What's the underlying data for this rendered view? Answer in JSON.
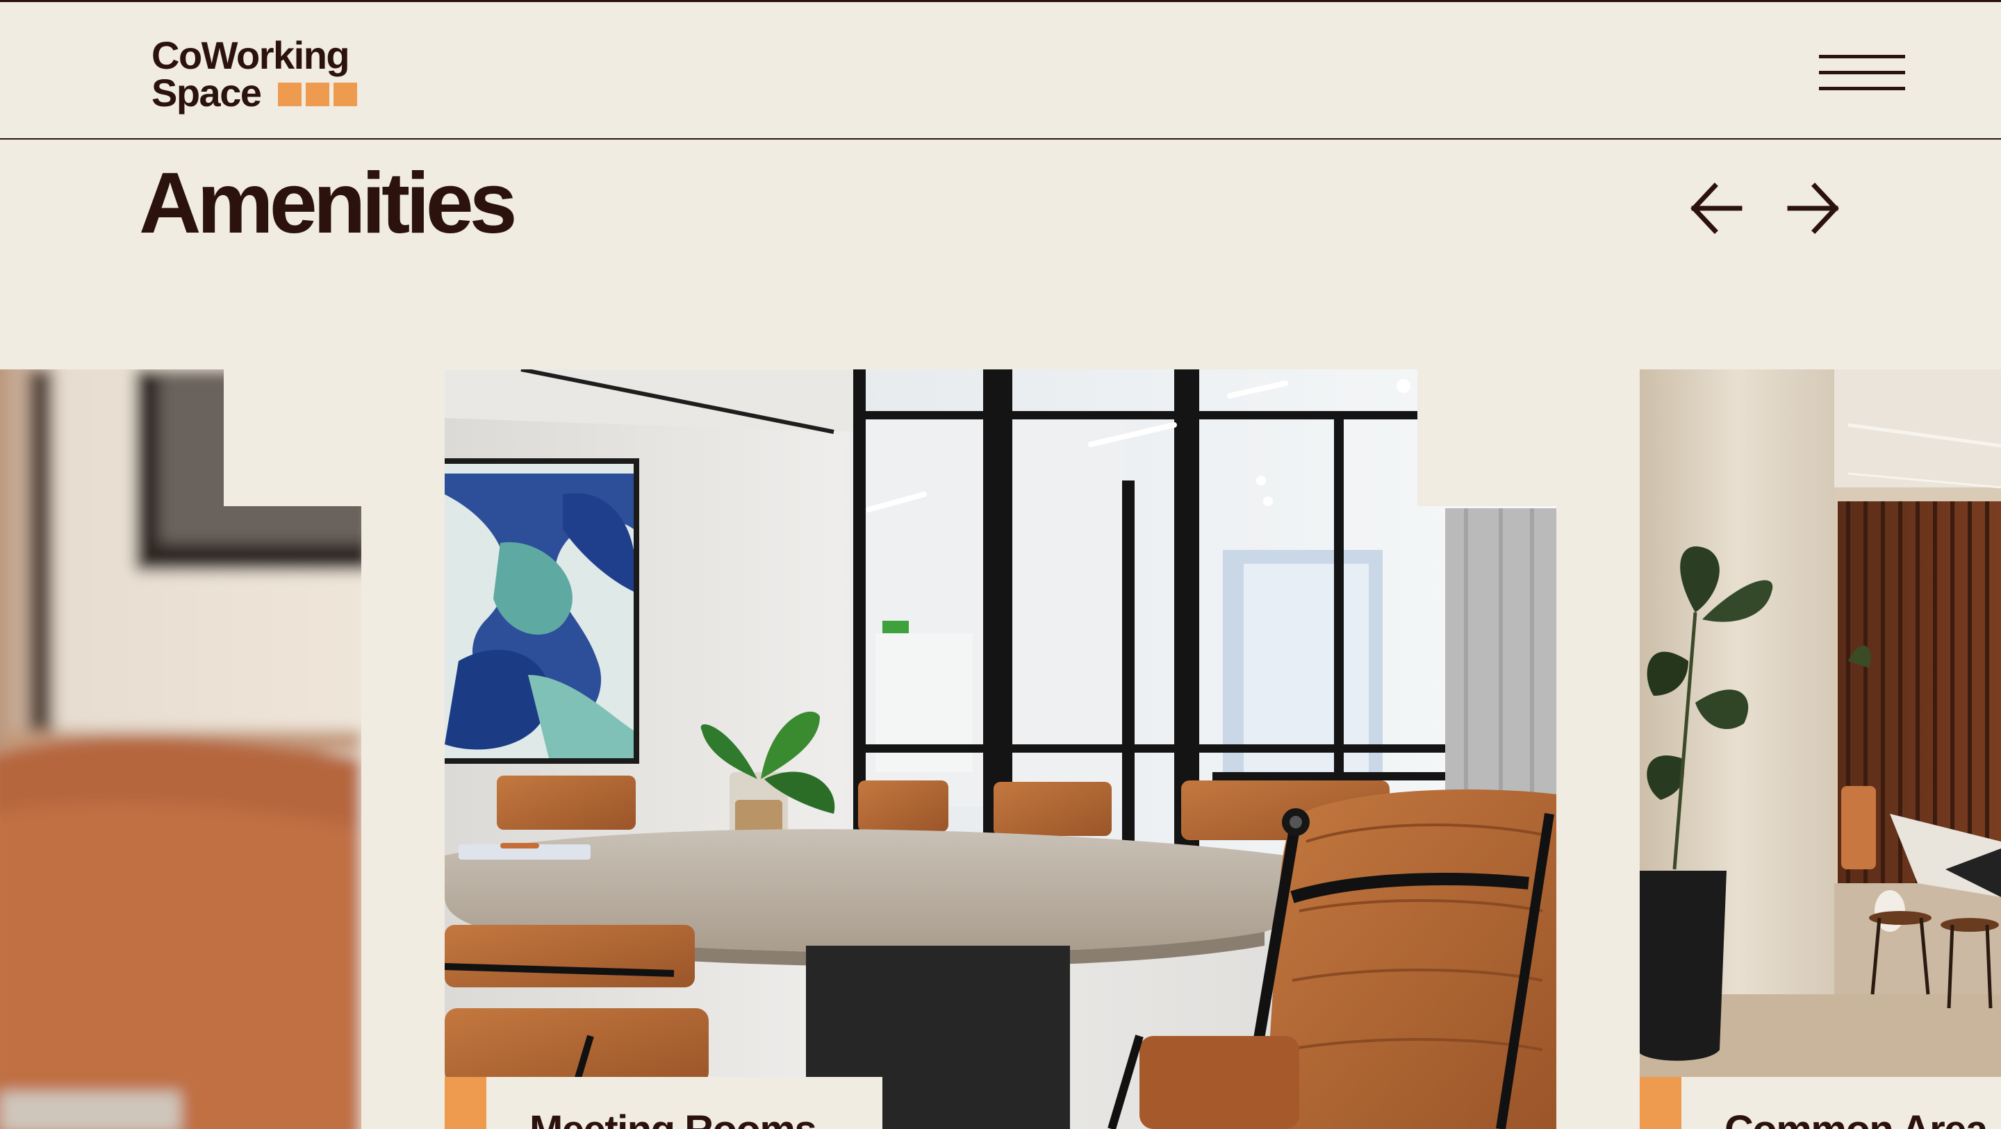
{
  "brand": {
    "name_line1": "CoWorking",
    "name_line2": "Space",
    "accent_color": "#ee9a4f",
    "text_color": "#2b120d",
    "background": "#f1ece2"
  },
  "header": {
    "menu_icon": "hamburger-menu-icon"
  },
  "section": {
    "title": "Amenities",
    "prev_icon": "arrow-left-icon",
    "next_icon": "arrow-right-icon"
  },
  "cards": [
    {
      "label": ""
    },
    {
      "label": "Meeting Rooms"
    },
    {
      "label": "Common Area"
    }
  ]
}
